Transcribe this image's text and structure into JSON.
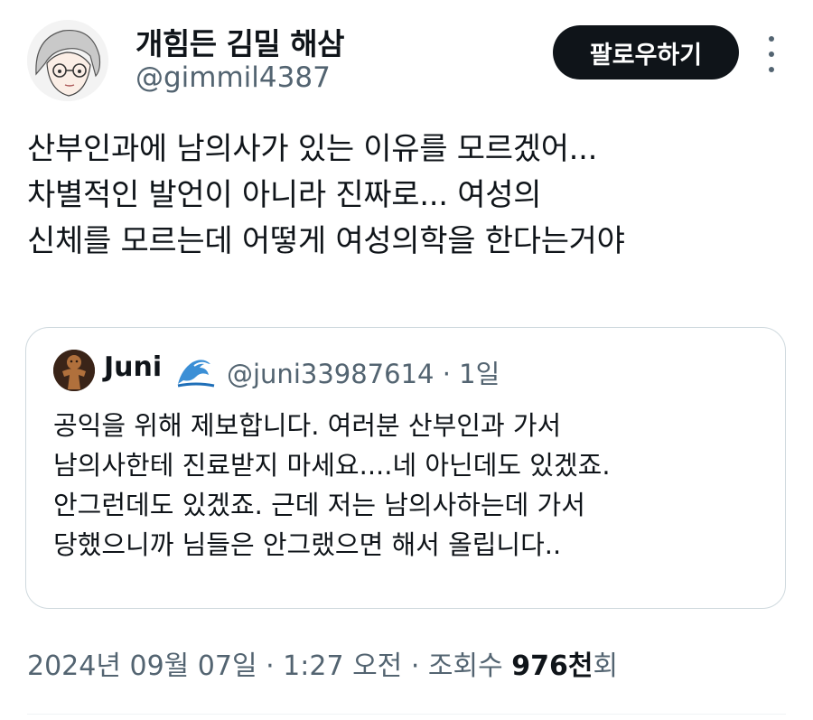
{
  "author": {
    "display_name": "개힘든 김밀 해삼",
    "handle": "@gimmil4387"
  },
  "actions": {
    "follow_label": "팔로우하기",
    "more_icon": "more-vertical-icon"
  },
  "tweet": {
    "lines": [
      "산부인과에 남의사가 있는 이유를 모르겠어...",
      "차별적인 발언이 아니라 진짜로... 여성의",
      "신체를 모르는데 어떻게 여성의학을 한다는거야"
    ]
  },
  "quote": {
    "name": "Juni",
    "emoji_icon": "wave-icon",
    "meta": "@juni33987614 · 1일",
    "lines": [
      "공익을 위해 제보합니다. 여러분 산부인과 가서",
      "남의사한테 진료받지 마세요....네 아닌데도 있겠죠.",
      "안그런데도 있겠죠. 근데 저는 남의사하는데 가서",
      "당했으니까 님들은 안그랬으면 해서 올립니다.."
    ]
  },
  "footer": {
    "timestamp": "2024년 09월 07일 · 1:27 오전 · 조회수 ",
    "views_number": "976천",
    "views_suffix": "회"
  }
}
